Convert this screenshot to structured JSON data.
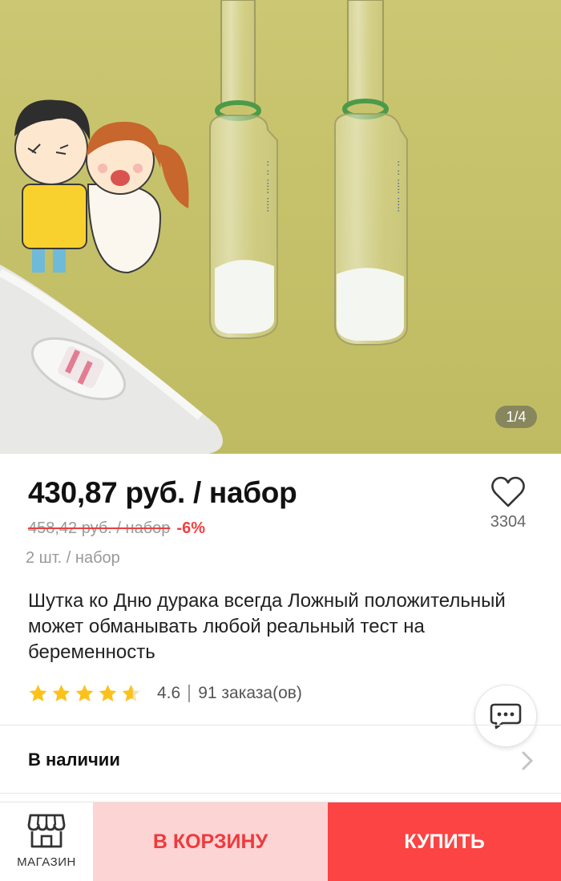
{
  "gallery": {
    "counter": "1/4",
    "background_color": "#c6c26b"
  },
  "price": {
    "current": "430,87 руб. / набор",
    "old": "458,42 руб. / набор",
    "discount": "-6%",
    "unit_info": "2 шт. / набор"
  },
  "wishlist": {
    "icon": "heart-outline-icon",
    "count": "3304"
  },
  "product": {
    "title": "Шутка ко Дню дурака всегда Ложный положительный может обманывать любой реальный тест на беременность"
  },
  "rating": {
    "stars_value": 4.6,
    "value": "4.6",
    "orders": "91 заказа(ов)",
    "star_color": "#fcc21b"
  },
  "chat": {
    "icon": "chat-bubble-icon"
  },
  "availability": {
    "label": "В наличии"
  },
  "bottom_bar": {
    "store_label": "МАГАЗИН",
    "cart_label": "В КОРЗИНУ",
    "buy_label": "КУПИТЬ",
    "cart_bg": "#fcd4d4",
    "buy_bg": "#fb4443"
  }
}
